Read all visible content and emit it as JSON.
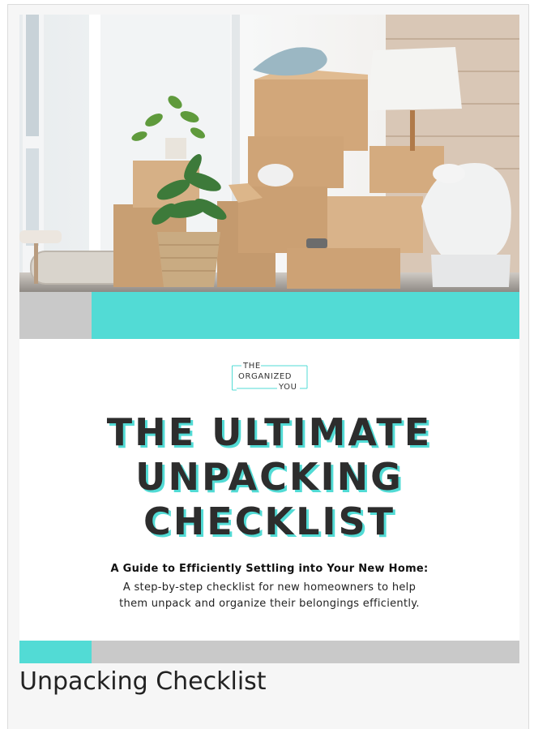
{
  "logo": {
    "line1": "THE",
    "line2": "ORGANIZED",
    "line3": "YOU"
  },
  "cover": {
    "title_lines": [
      "THE ULTIMATE",
      "UNPACKING",
      "CHECKLIST"
    ],
    "subtitle_heading": "A Guide to Efficiently Settling into Your New Home:",
    "subtitle_lines": [
      "A step-by-step checklist for new homeowners to help",
      "them unpack and organize their belongings efficiently."
    ]
  },
  "caption": "Unpacking Checklist",
  "colors": {
    "accent": "#52dbd5",
    "band_gray": "#c9c9c9",
    "text_dark": "#2d2d2d"
  }
}
